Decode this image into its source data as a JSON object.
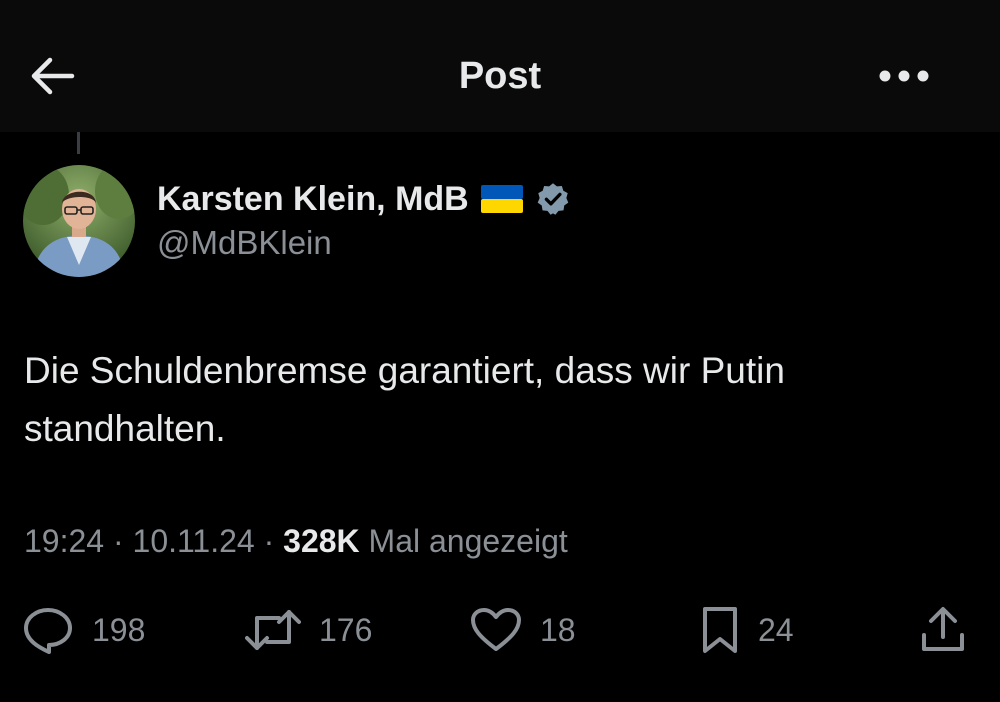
{
  "header": {
    "title": "Post",
    "back_icon": "arrow-left-icon",
    "more_icon": "more-horizontal-icon"
  },
  "author": {
    "display_name": "Karsten Klein, MdB",
    "handle": "@MdBKlein",
    "flag_icon": "ukraine-flag-icon",
    "verified_icon": "verified-badge-icon",
    "verified_color": "#829aab"
  },
  "post": {
    "text": "Die Schuldenbremse garantiert, dass wir Putin standhalten."
  },
  "meta": {
    "time": "19:24",
    "separator": " · ",
    "date": "10.11.24",
    "views_count": "328K",
    "views_label": "Mal angezeigt"
  },
  "actions": {
    "replies": "198",
    "reposts": "176",
    "likes": "18",
    "bookmarks": "24",
    "share_icon": "share-icon"
  },
  "colors": {
    "background": "#000000",
    "header_background": "#0a0a0a",
    "text_primary": "#e7e9ea",
    "text_secondary": "#8b9096",
    "flag_blue": "#0057b7",
    "flag_yellow": "#ffd700"
  }
}
